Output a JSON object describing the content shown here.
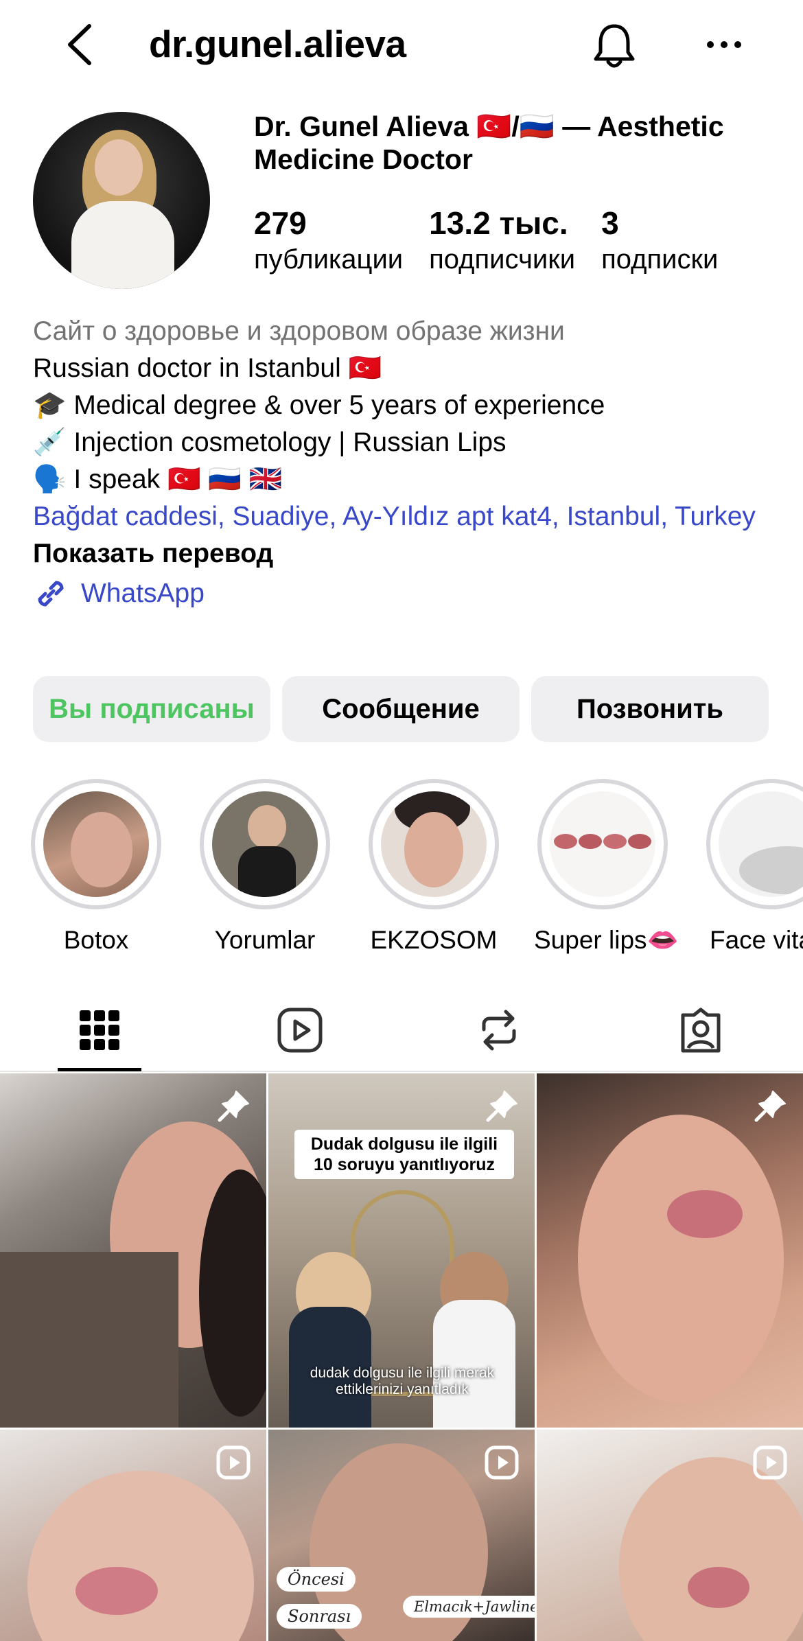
{
  "header": {
    "username": "dr.gunel.alieva"
  },
  "profile": {
    "display_name": "Dr. Gunel Alieva 🇹🇷/🇷🇺 — Aesthetic Medicine Doctor",
    "stats": [
      {
        "num": "279",
        "label": "публикации"
      },
      {
        "num": "13.2 тыс.",
        "label": "подписчики"
      },
      {
        "num": "3",
        "label": "подписки"
      }
    ]
  },
  "bio": {
    "category": "Сайт о здоровье и здоровом образе жизни",
    "lines": [
      "Russian doctor in Istanbul 🇹🇷",
      "🎓 Medical degree & over 5 years of experience",
      "💉 Injection cosmetology | Russian Lips",
      "🗣️ I speak 🇹🇷 🇷🇺 🇬🇧"
    ],
    "address": "Bağdat caddesi, Suadiye, Ay-Yıldız apt kat4, Istanbul, Turkey",
    "translate": "Показать перевод",
    "link": "WhatsApp"
  },
  "actions": {
    "follow": "Вы подписаны",
    "message": "Сообщение",
    "call": "Позвонить"
  },
  "highlights": [
    {
      "label": "Botox"
    },
    {
      "label": "Yorumlar"
    },
    {
      "label": "EKZOSOM"
    },
    {
      "label": "Super lips👄"
    },
    {
      "label": "Face vitan"
    }
  ],
  "posts": {
    "p2_title": "Dudak dolgusu ile ilgili 10 soruyu yanıtlıyoruz",
    "p2_caption": "dudak dolgusu ile ilgili merak ettiklerinizi yanıtladık",
    "p5_tag1": "Öncesi",
    "p5_tag2": "Sonrası",
    "p5_tag3": "Elmacık+Jawline"
  },
  "colors": {
    "link": "#3848c9",
    "follow_green": "#4ec561",
    "button_bg": "#efeff1"
  }
}
